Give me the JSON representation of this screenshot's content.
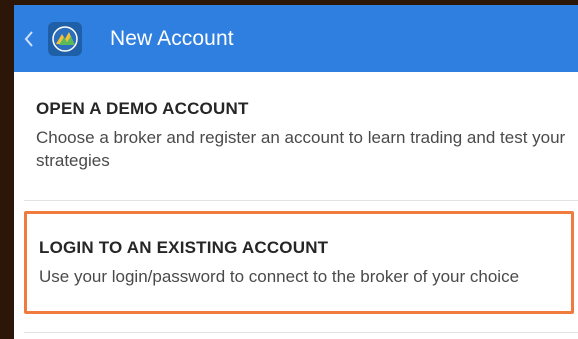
{
  "header": {
    "title": "New Account",
    "back_icon": "chevron-left-icon",
    "app_icon": "metatrader-logo-icon",
    "background_color": "#2f7fe0"
  },
  "options": [
    {
      "heading": "OPEN A DEMO ACCOUNT",
      "description": "Choose a broker and register an account to learn trading and test your strategies"
    },
    {
      "heading": "LOGIN TO AN EXISTING ACCOUNT",
      "description": "Use your login/password to connect to the broker of your choice",
      "highlight_color": "#f07b3f"
    }
  ]
}
